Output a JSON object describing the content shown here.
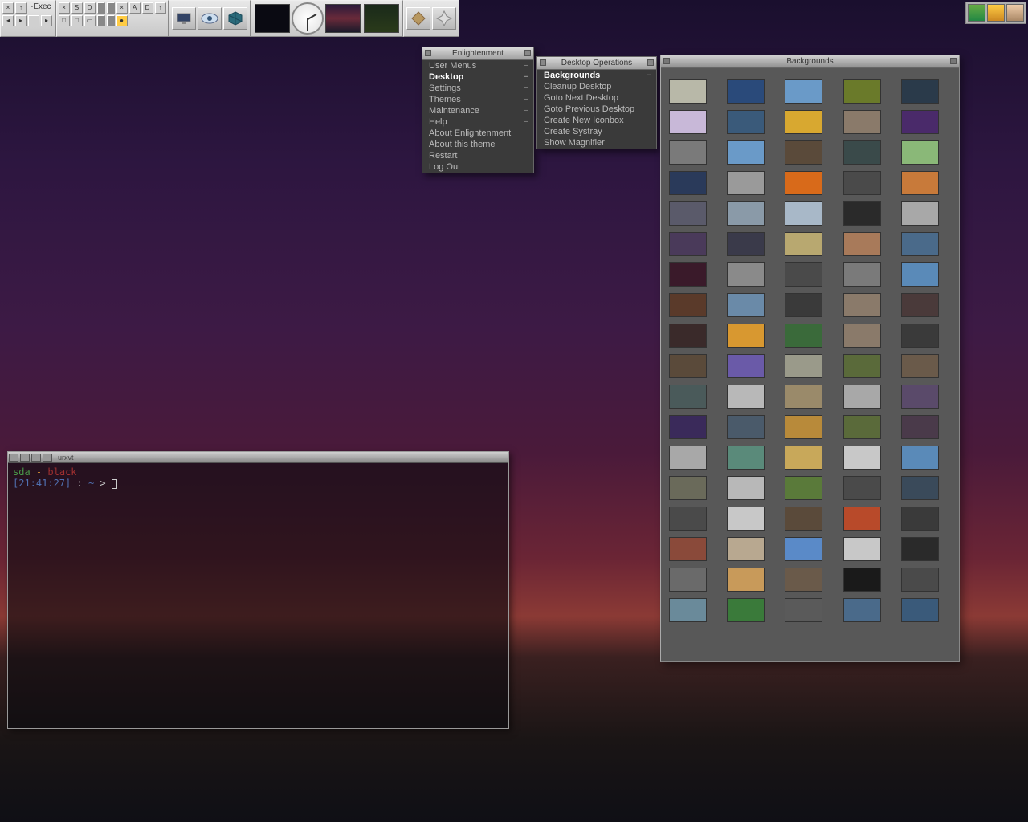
{
  "toolbar": {
    "exec_label": "-Exec"
  },
  "systray_icons": [
    {
      "name": "shield-icon",
      "bg": "linear-gradient(#6a4, #284)"
    },
    {
      "name": "chat-icon",
      "bg": "linear-gradient(#fc4, #c82)"
    },
    {
      "name": "user-icon",
      "bg": "linear-gradient(#eca, #a86)"
    }
  ],
  "root_menu": {
    "title": "Enlightenment",
    "items": [
      {
        "label": "User Menus",
        "submenu": true
      },
      {
        "label": "Desktop",
        "submenu": true,
        "selected": true
      },
      {
        "label": "Settings",
        "submenu": true
      },
      {
        "label": "Themes",
        "submenu": true
      },
      {
        "label": "Maintenance",
        "submenu": true
      },
      {
        "label": "Help",
        "submenu": true
      },
      {
        "label": "About Enlightenment"
      },
      {
        "label": "About this theme"
      },
      {
        "label": "Restart"
      },
      {
        "label": "Log Out"
      }
    ]
  },
  "desktop_menu": {
    "title": "Desktop Operations",
    "items": [
      {
        "label": "Backgrounds",
        "submenu": true,
        "selected": true
      },
      {
        "label": "Cleanup Desktop"
      },
      {
        "label": "Goto Next Desktop"
      },
      {
        "label": "Goto Previous Desktop"
      },
      {
        "label": "Create New Iconbox"
      },
      {
        "label": "Create Systray"
      },
      {
        "label": "Show Magnifier"
      }
    ]
  },
  "bg_panel": {
    "title": "Backgrounds",
    "thumbs": [
      "#b8b8a8",
      "#2a4a7a",
      "#6a9ac8",
      "#6a7a2a",
      "#2a3a4a",
      "#c8b8d8",
      "#3a5a7a",
      "#d8a830",
      "#8a7a6a",
      "#4a2a6a",
      "#7a7a7a",
      "#6a9ac8",
      "#5a4a3a",
      "#3a4a4a",
      "#8ab878",
      "#2a3a5a",
      "#9a9a9a",
      "#d86a1a",
      "#4a4a4a",
      "#c87a3a",
      "#5a5a6a",
      "#8a9aa8",
      "#a8b8c8",
      "#2a2a2a",
      "#a8a8a8",
      "#4a3a5a",
      "#3a3a4a",
      "#b8a870",
      "#a87a5a",
      "#4a6a8a",
      "#3a1a2a",
      "#8a8a8a",
      "#4a4a4a",
      "#7a7a7a",
      "#5a8ab8",
      "#5a3a2a",
      "#6a8aa8",
      "#3a3a3a",
      "#8a7a6a",
      "#4a3a3a",
      "#3a2a2a",
      "#d89830",
      "#3a6a3a",
      "#8a7a6a",
      "#3a3a3a",
      "#5a4a3a",
      "#6a5aa8",
      "#9a9a8a",
      "#5a6a3a",
      "#6a5a4a",
      "#4a5a5a",
      "#b8b8b8",
      "#9a8a6a",
      "#a8a8a8",
      "#5a4a6a",
      "#3a2a5a",
      "#4a5a6a",
      "#b88a3a",
      "#5a6a3a",
      "#4a3a4a",
      "#a8a8a8",
      "#5a8a7a",
      "#c8a85a",
      "#c8c8c8",
      "#5a8ab8",
      "#6a6a5a",
      "#b8b8b8",
      "#5a7a3a",
      "#4a4a4a",
      "#3a4a5a",
      "#4a4a4a",
      "#c8c8c8",
      "#5a4a3a",
      "#b84a2a",
      "#3a3a3a",
      "#8a4a3a",
      "#b8a890",
      "#5a8ac8",
      "#c8c8c8",
      "#2a2a2a",
      "#6a6a6a",
      "#c89a5a",
      "#6a5a4a",
      "#1a1a1a",
      "#4a4a4a",
      "#6a8a9a",
      "#3a7a3a",
      "#5a5a5a",
      "#4a6a8a",
      "#3a5a7a"
    ]
  },
  "terminal": {
    "title": "urxvt",
    "host": "sda",
    "sep": "-",
    "user": "black",
    "time": "[21:41:27]",
    "prompt1": ":",
    "prompt2": "~",
    "prompt3": ">"
  }
}
